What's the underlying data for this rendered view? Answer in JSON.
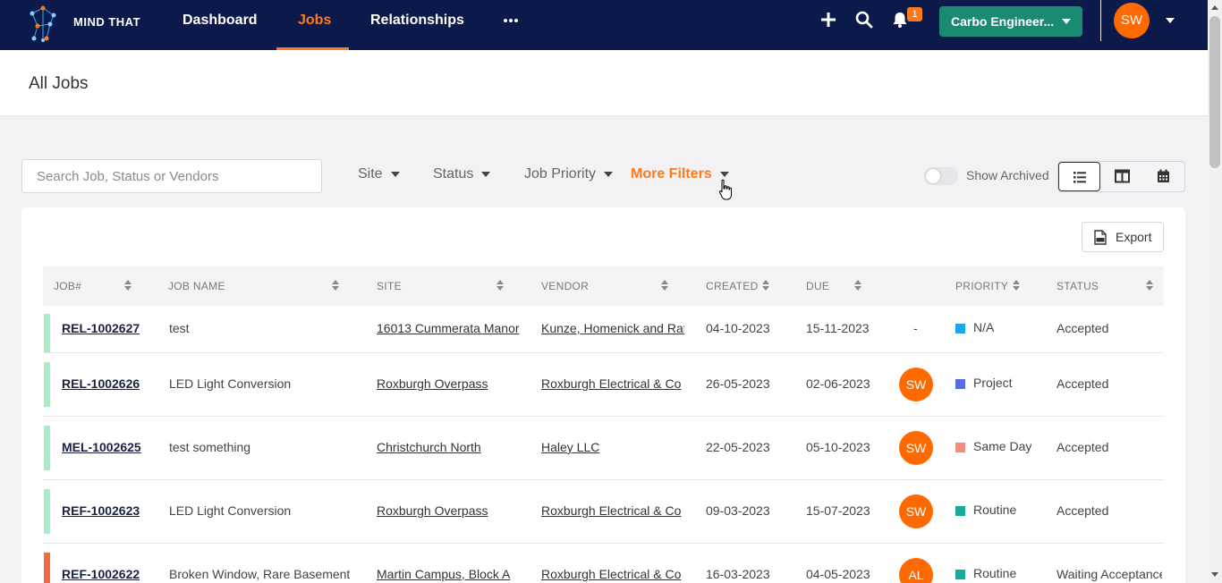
{
  "app": {
    "logo_text": "MIND THAT"
  },
  "nav": {
    "items": [
      {
        "label": "Dashboard"
      },
      {
        "label": "Jobs"
      },
      {
        "label": "Relationships"
      }
    ],
    "notification_count": "1",
    "company": "Carbo Engineer...",
    "user_initials": "SW"
  },
  "page": {
    "title": "All Jobs"
  },
  "filters": {
    "search_placeholder": "Search Job, Status or Vendors",
    "site": "Site",
    "status": "Status",
    "job_priority": "Job Priority",
    "more_filters": "More Filters",
    "show_archived": "Show Archived"
  },
  "toolbar": {
    "export_label": "Export"
  },
  "table": {
    "columns": [
      "JOB#",
      "JOB NAME",
      "SITE",
      "VENDOR",
      "CREATED",
      "DUE",
      "PRIORITY",
      "STATUS"
    ],
    "rows": [
      {
        "job_no": "REL-1002627",
        "job_name": "test",
        "site": "16013 Cummerata Manor",
        "vendor": "Kunze, Homenick and Rath",
        "created": "04-10-2023",
        "due": "15-11-2023",
        "assignee": "-",
        "priority": "N/A",
        "priority_color": "#1aa6e8",
        "status": "Accepted",
        "status_color": "#a8ecc8"
      },
      {
        "job_no": "REL-1002626",
        "job_name": "LED Light Conversion",
        "site": "Roxburgh Overpass",
        "vendor": "Roxburgh Electrical & Co",
        "created": "26-05-2023",
        "due": "02-06-2023",
        "assignee": "SW",
        "priority": "Project",
        "priority_color": "#5b6be8",
        "status": "Accepted",
        "status_color": "#a8ecc8"
      },
      {
        "job_no": "MEL-1002625",
        "job_name": "test something",
        "site": "Christchurch North",
        "vendor": "Haley LLC",
        "created": "22-05-2023",
        "due": "05-10-2023",
        "assignee": "SW",
        "priority": "Same Day",
        "priority_color": "#f08c80",
        "status": "Accepted",
        "status_color": "#a8ecc8"
      },
      {
        "job_no": "REF-1002623",
        "job_name": "LED Light Conversion",
        "site": "Roxburgh Overpass",
        "vendor": "Roxburgh Electrical & Co",
        "created": "09-03-2023",
        "due": "15-07-2023",
        "assignee": "SW",
        "priority": "Routine",
        "priority_color": "#1aa89a",
        "status": "Accepted",
        "status_color": "#a8ecc8"
      },
      {
        "job_no": "REF-1002622",
        "job_name": "Broken Window, Rare Basement",
        "site": "Martin Campus, Block A",
        "vendor": "Roxburgh Electrical & Co",
        "created": "16-03-2023",
        "due": "04-05-2023",
        "assignee": "AL",
        "priority": "Routine",
        "priority_color": "#1aa89a",
        "status": "Waiting Acceptance",
        "status_color": "#f06a45"
      }
    ]
  }
}
